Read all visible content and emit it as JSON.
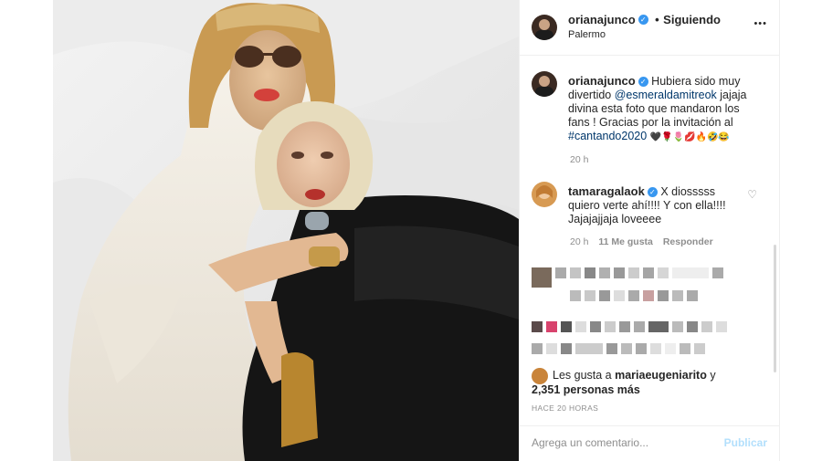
{
  "post": {
    "username": "orianajunco",
    "follow_label": "Siguiendo",
    "separator": "•",
    "location": "Palermo",
    "more_icon": "•••"
  },
  "caption": {
    "username": "orianajunco",
    "text_before": "Hubiera sido muy divertido ",
    "mention": "@esmeraldamitreok",
    "text_after": " jajaja divina esta foto que mandaron los fans ! Gracias por la invitación al ",
    "hashtag": "#cantando2020",
    "emojis": "🖤🌹🌷💋🔥🤣😂",
    "time": "20 h"
  },
  "comment": {
    "username": "tamaragalaok",
    "text": "X diosssss quiero verte ahí!!!! Y con ella!!!! Jajajajjaja loveeee",
    "time": "20 h",
    "likes": "11 Me gusta",
    "reply": "Responder"
  },
  "likes": {
    "prefix": "Les gusta a ",
    "user": "mariaeugeniarito",
    "suffix": " y",
    "others": "2,351 personas más"
  },
  "timestamp": "HACE 20 HORAS",
  "add_comment": {
    "placeholder": "Agrega un comentario...",
    "publish": "Publicar"
  },
  "icons": {
    "verified": "verified-badge-icon",
    "heart": "heart-icon",
    "more": "more-options-icon"
  },
  "colors": {
    "link": "#00376b",
    "verified": "#3897f0",
    "publish_disabled": "#b2dffc",
    "muted": "#8e8e8e"
  }
}
